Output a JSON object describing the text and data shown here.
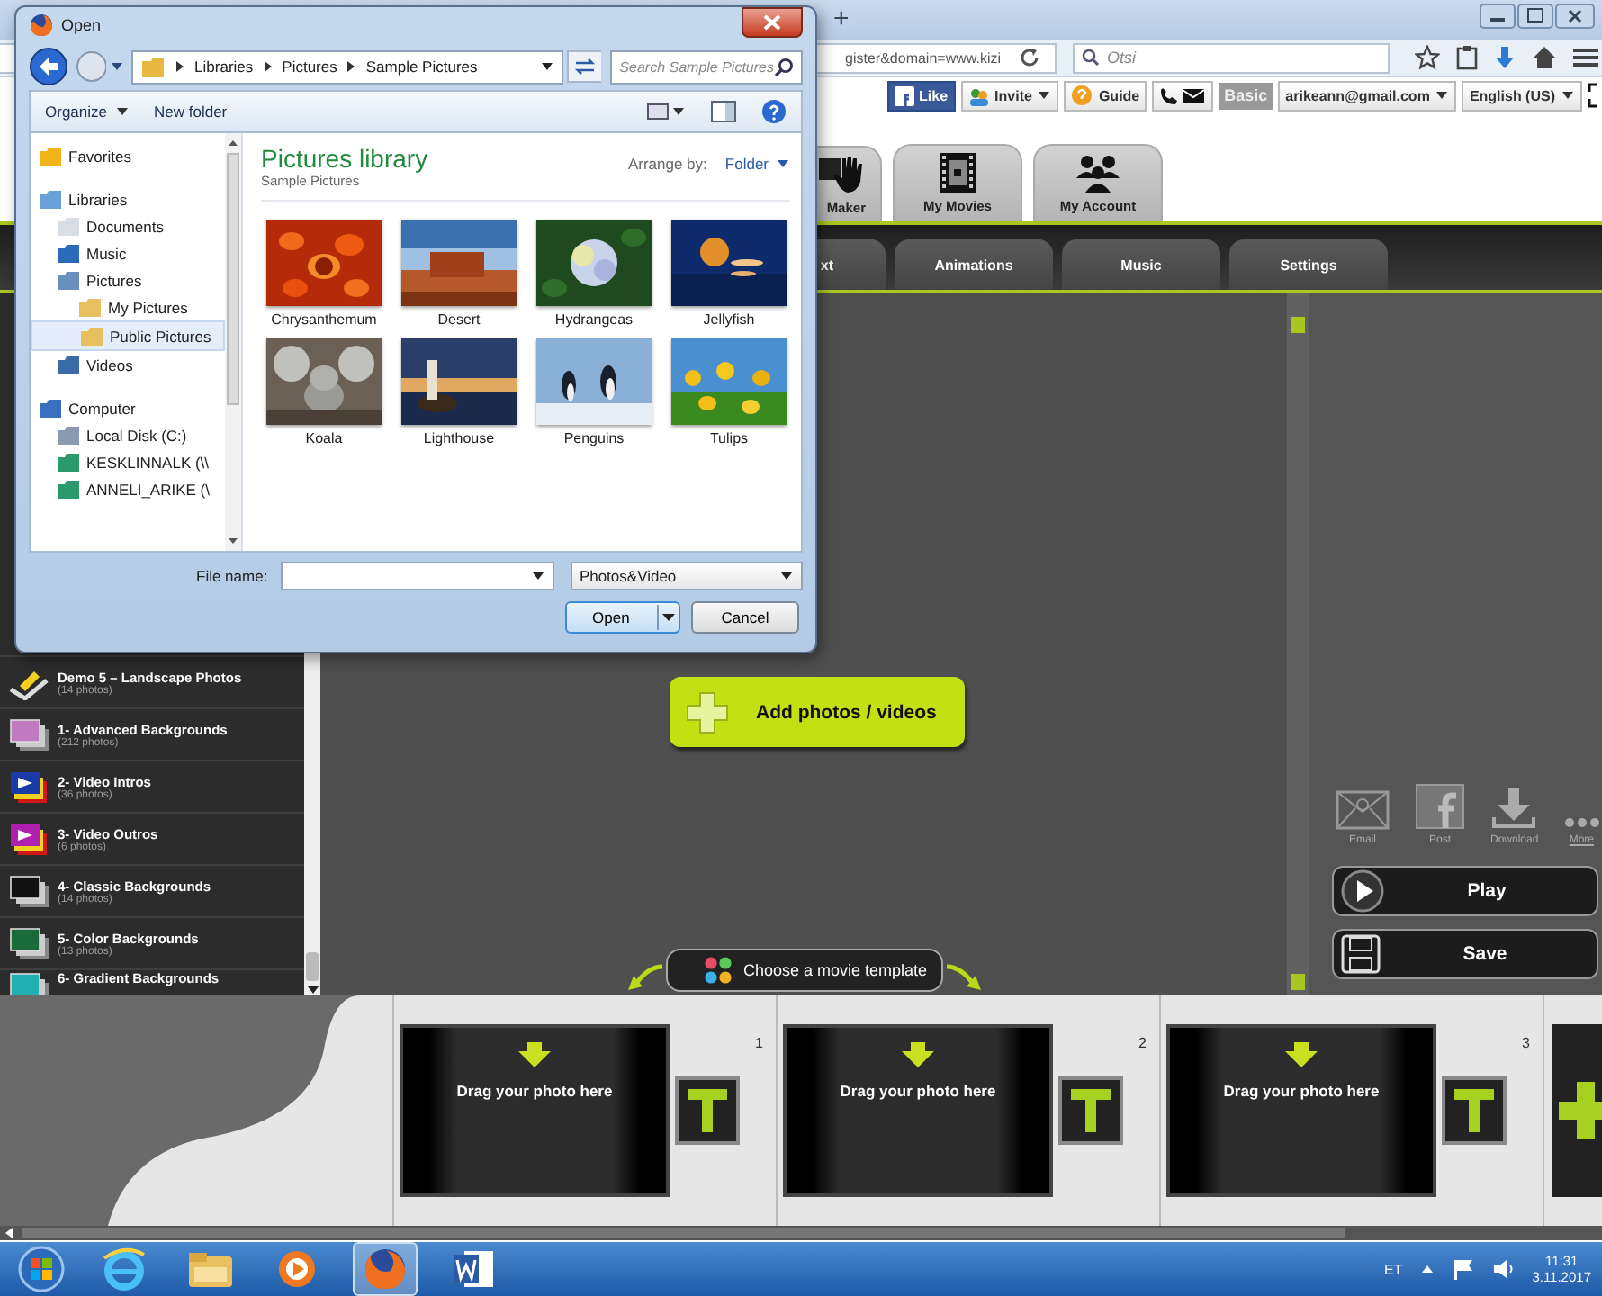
{
  "dialog": {
    "title": "Open",
    "breadcrumb": [
      "Libraries",
      "Pictures",
      "Sample Pictures"
    ],
    "search": {
      "placeholder": "Search Sample Pictures"
    },
    "toolbar": [
      "Organize",
      "New folder"
    ],
    "nav": [
      {
        "label": "Favorites",
        "selected": false
      },
      {
        "label": "Libraries",
        "selected": false,
        "children": [
          {
            "label": "Documents",
            "selected": false
          },
          {
            "label": "Music",
            "selected": false
          },
          {
            "label": "Pictures",
            "selected": false,
            "children": [
              {
                "label": "My Pictures",
                "selected": false
              },
              {
                "label": "Public Pictures",
                "selected": true
              }
            ]
          },
          {
            "label": "Videos",
            "selected": false
          }
        ]
      },
      {
        "label": "Computer",
        "selected": false,
        "children": [
          {
            "label": "Local Disk (C:)",
            "selected": false
          },
          {
            "label": "KESKLINNALK (\\\\",
            "selected": false
          },
          {
            "label": "ANNELI_ARIKE (\\",
            "selected": false
          }
        ]
      }
    ],
    "library_title": "Pictures library",
    "library_subtitle": "Sample Pictures",
    "arrange_label": "Arrange by:",
    "arrange_value": "Folder",
    "files": [
      {
        "name": "Chrysanthemum",
        "kind": "picture"
      },
      {
        "name": "Desert",
        "kind": "picture"
      },
      {
        "name": "Hydrangeas",
        "kind": "picture"
      },
      {
        "name": "Jellyfish",
        "kind": "picture"
      },
      {
        "name": "Koala",
        "kind": "picture"
      },
      {
        "name": "Lighthouse",
        "kind": "picture"
      },
      {
        "name": "Penguins",
        "kind": "picture"
      },
      {
        "name": "Tulips",
        "kind": "picture"
      }
    ],
    "filename_label": "File name:",
    "filter": "Photos&Video",
    "buttons": [
      "Open",
      "Cancel"
    ]
  },
  "browser": {
    "new_tab": "+",
    "url": "gister&domain=www.kizi",
    "search": {
      "placeholder": "Otsi"
    }
  },
  "site_toolbar": {
    "like": "Like",
    "invite": "Invite",
    "guide": "Guide",
    "plan": "Basic",
    "account": "arikeann@gmail.com",
    "language": "English (US)"
  },
  "main_tabs": [
    {
      "label": "Maker",
      "selected": false
    },
    {
      "label": "My Movies",
      "selected": false
    },
    {
      "label": "My Account",
      "selected": false
    }
  ],
  "sub_tabs": [
    {
      "label": "xt",
      "selected": false
    },
    {
      "label": "Animations",
      "selected": false
    },
    {
      "label": "Music",
      "selected": false
    },
    {
      "label": "Settings",
      "selected": false
    }
  ],
  "categories": [
    {
      "title": "Demo 5 – Landscape Photos",
      "count": "(14 photos)",
      "kind": "demo",
      "color": "#f0d020"
    },
    {
      "title": "1- Advanced Backgrounds",
      "count": "(212 photos)",
      "kind": "stack",
      "color": "#c07ac0"
    },
    {
      "title": "2- Video Intros",
      "count": "(36 photos)",
      "kind": "video",
      "color": "#1a3aa8"
    },
    {
      "title": "3- Video Outros",
      "count": "(6 photos)",
      "kind": "video",
      "color": "#b020b0"
    },
    {
      "title": "4- Classic Backgrounds",
      "count": "(14 photos)",
      "kind": "stack",
      "color": "#111111"
    },
    {
      "title": "5- Color Backgrounds",
      "count": "(13 photos)",
      "kind": "stack",
      "color": "#1a6a3a"
    },
    {
      "title": "6- Gradient Backgrounds",
      "kind": "stack",
      "color": "#20b0b0"
    }
  ],
  "add_button": "Add photos / videos",
  "share": [
    "Email",
    "Post",
    "Download",
    "More"
  ],
  "play": "Play",
  "save": "Save",
  "template_button": "Choose a movie template",
  "slides": [
    {
      "number": "1",
      "text": "Drag your photo here"
    },
    {
      "number": "2",
      "text": "Drag your photo here"
    },
    {
      "number": "3",
      "text": "Drag your photo here"
    }
  ],
  "taskbar": {
    "language": "ET",
    "time": "11:31",
    "date": "3.11.2017"
  }
}
